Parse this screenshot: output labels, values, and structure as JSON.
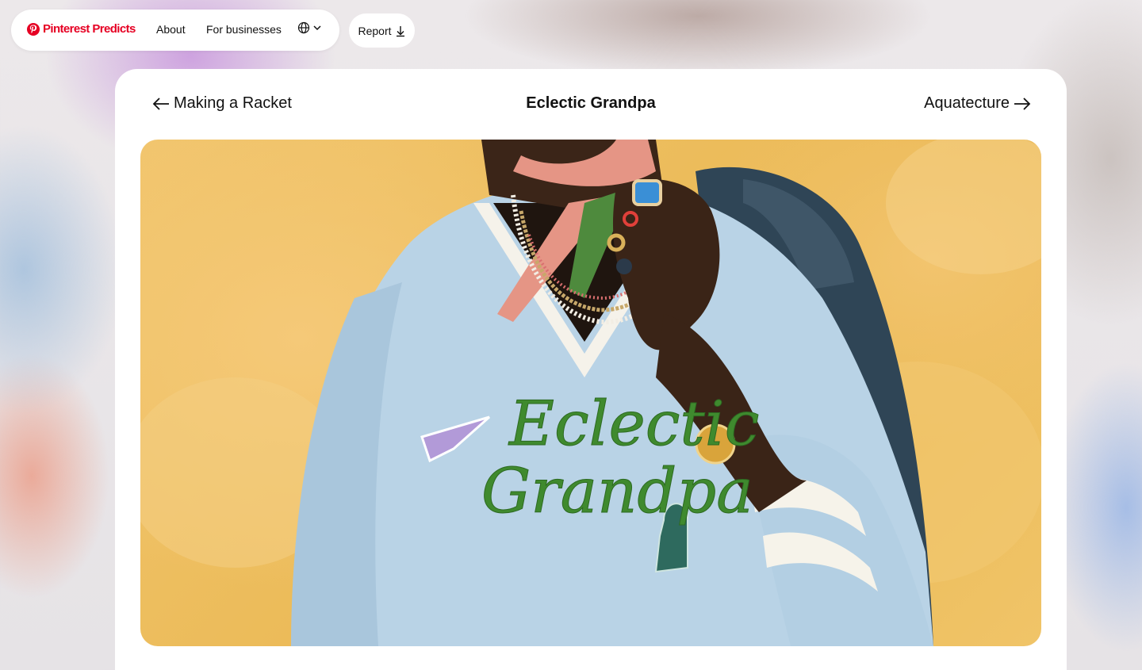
{
  "nav": {
    "brand": "Pinterest Predicts",
    "about": "About",
    "for_businesses": "For businesses",
    "report": "Report"
  },
  "trend": {
    "prev": "Making a Racket",
    "title": "Eclectic Grandpa",
    "next": "Aquatecture"
  },
  "hero": {
    "sweater_script_line1": "Eclectic",
    "sweater_script_line2": "Grandpa"
  },
  "colors": {
    "brand_red": "#e60023",
    "background_yellow": "#f1c56d",
    "sweater_blue": "#b9d3e6",
    "script_green": "#3f8a2e"
  },
  "icons": [
    "pinterest-logo-icon",
    "globe-icon",
    "chevron-down-icon",
    "download-icon",
    "arrow-left-icon",
    "arrow-right-icon"
  ]
}
